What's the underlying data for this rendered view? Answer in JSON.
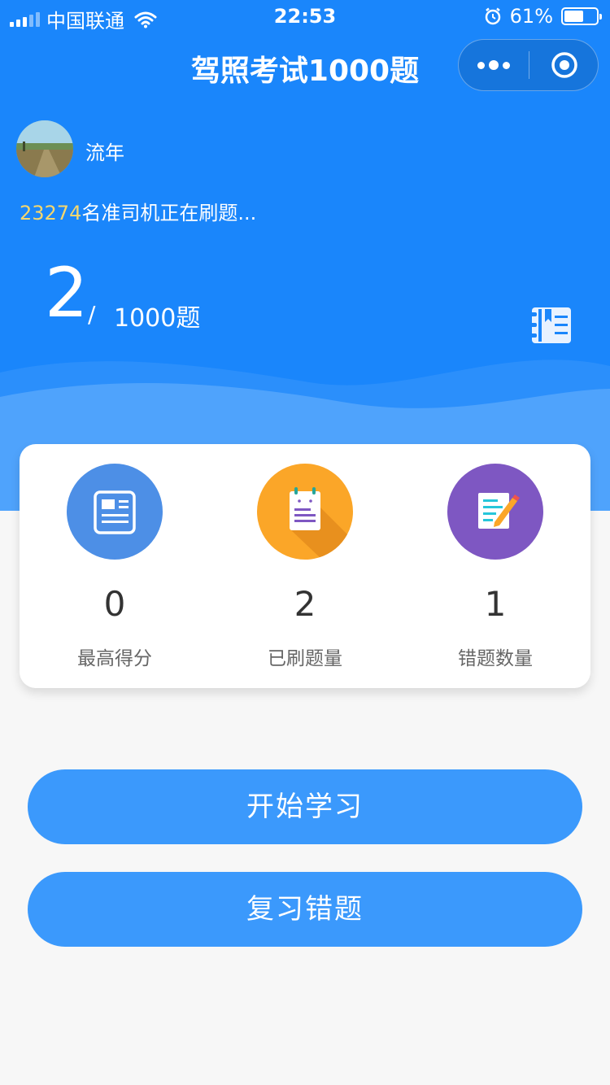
{
  "status_bar": {
    "carrier": "中国联通",
    "time": "22:53",
    "battery_percent": "61%",
    "battery_level": 0.61,
    "icons": [
      "signal-icon",
      "wifi-icon",
      "alarm-icon",
      "battery-icon"
    ]
  },
  "nav": {
    "title": "驾照考试1000题",
    "more_icon": "more-dots-icon",
    "close_icon": "target-close-icon"
  },
  "user": {
    "name": "流年",
    "active_count": "23274",
    "active_suffix": "名准司机正在刷题..."
  },
  "progress": {
    "done": "2",
    "slash": "/",
    "total": "1000题"
  },
  "stats": [
    {
      "value": "0",
      "label": "最高得分",
      "icon": "score-card-icon",
      "color": "#4d8fe6"
    },
    {
      "value": "2",
      "label": "已刷题量",
      "icon": "notepad-icon",
      "color": "#fba628"
    },
    {
      "value": "1",
      "label": "错题数量",
      "icon": "edit-note-icon",
      "color": "#7e57c2"
    }
  ],
  "buttons": {
    "start": "开始学习",
    "review": "复习错题"
  },
  "colors": {
    "primary": "#1a86fb",
    "button": "#3b99fc",
    "highlight": "#f5d76e",
    "background": "#f7f7f7"
  }
}
